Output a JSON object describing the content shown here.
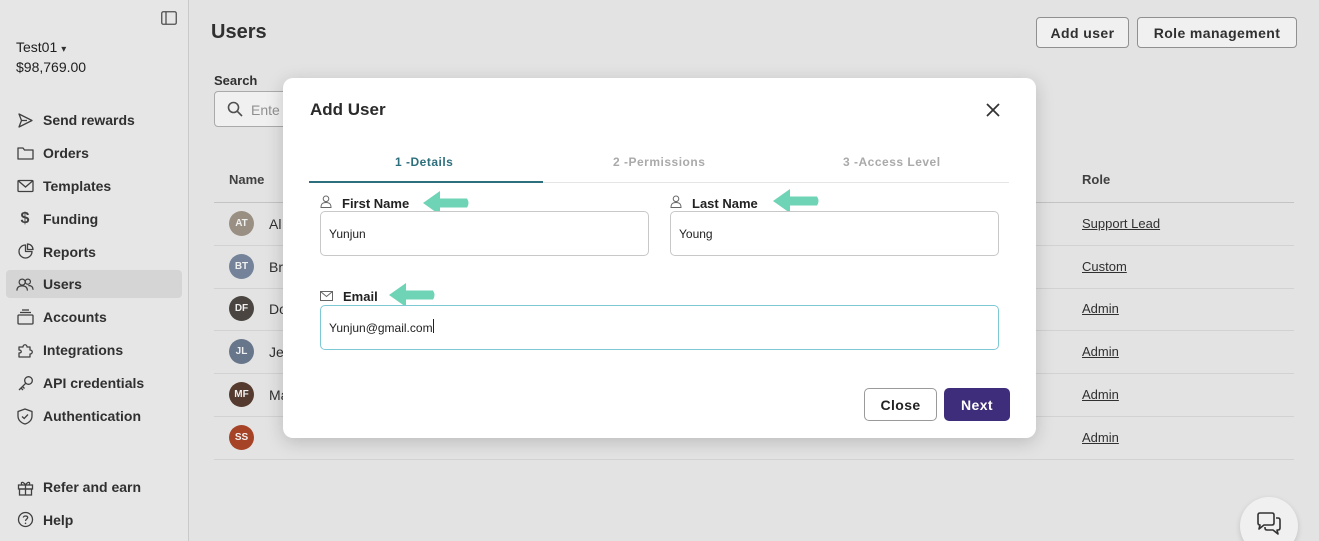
{
  "sidebar": {
    "account_name": "Test01",
    "account_balance": "$98,769.00",
    "items": [
      {
        "label": "Send rewards",
        "icon": "send-icon"
      },
      {
        "label": "Orders",
        "icon": "folder-icon"
      },
      {
        "label": "Templates",
        "icon": "mail-icon"
      },
      {
        "label": "Funding",
        "icon": "dollar-icon"
      },
      {
        "label": "Reports",
        "icon": "chart-icon"
      },
      {
        "label": "Users",
        "icon": "users-icon",
        "active": true
      },
      {
        "label": "Accounts",
        "icon": "stack-icon"
      },
      {
        "label": "Integrations",
        "icon": "puzzle-icon"
      },
      {
        "label": "API credentials",
        "icon": "key-icon"
      },
      {
        "label": "Authentication",
        "icon": "shield-icon"
      }
    ],
    "bottom_items": [
      {
        "label": "Refer and earn",
        "icon": "gift-icon"
      },
      {
        "label": "Help",
        "icon": "help-icon"
      }
    ]
  },
  "main": {
    "title": "Users",
    "add_user_label": "Add user",
    "role_management_label": "Role management",
    "search_label": "Search",
    "search_placeholder": "Ente",
    "columns": {
      "name": "Name",
      "role": "Role"
    },
    "rows": [
      {
        "initials": "AT",
        "name": "Al",
        "role": "Support Lead",
        "color": "#a39a8c"
      },
      {
        "initials": "BT",
        "name": "Br",
        "role": "Custom",
        "color": "#7c8ca3"
      },
      {
        "initials": "DF",
        "name": "Do",
        "role": "Admin",
        "color": "#4f4a45"
      },
      {
        "initials": "JL",
        "name": "Je",
        "role": "Admin",
        "color": "#6f7e95"
      },
      {
        "initials": "MF",
        "name": "Ma",
        "role": "Admin",
        "color": "#5a3e32"
      },
      {
        "initials": "SS",
        "name": "",
        "role": "Admin",
        "color": "#b1482a"
      }
    ]
  },
  "modal": {
    "title": "Add User",
    "tabs": [
      "1 -Details",
      "2 -Permissions",
      "3 -Access Level"
    ],
    "first_name_label": "First Name",
    "first_name_value": "Yunjun",
    "last_name_label": "Last Name",
    "last_name_value": "Young",
    "email_label": "Email",
    "email_value": "Yunjun@gmail.com",
    "close_label": "Close",
    "next_label": "Next"
  },
  "colors": {
    "accent_teal": "#2d6f7c",
    "primary_button": "#3d2d7a",
    "annotation_arrow": "#6fd3b5"
  }
}
